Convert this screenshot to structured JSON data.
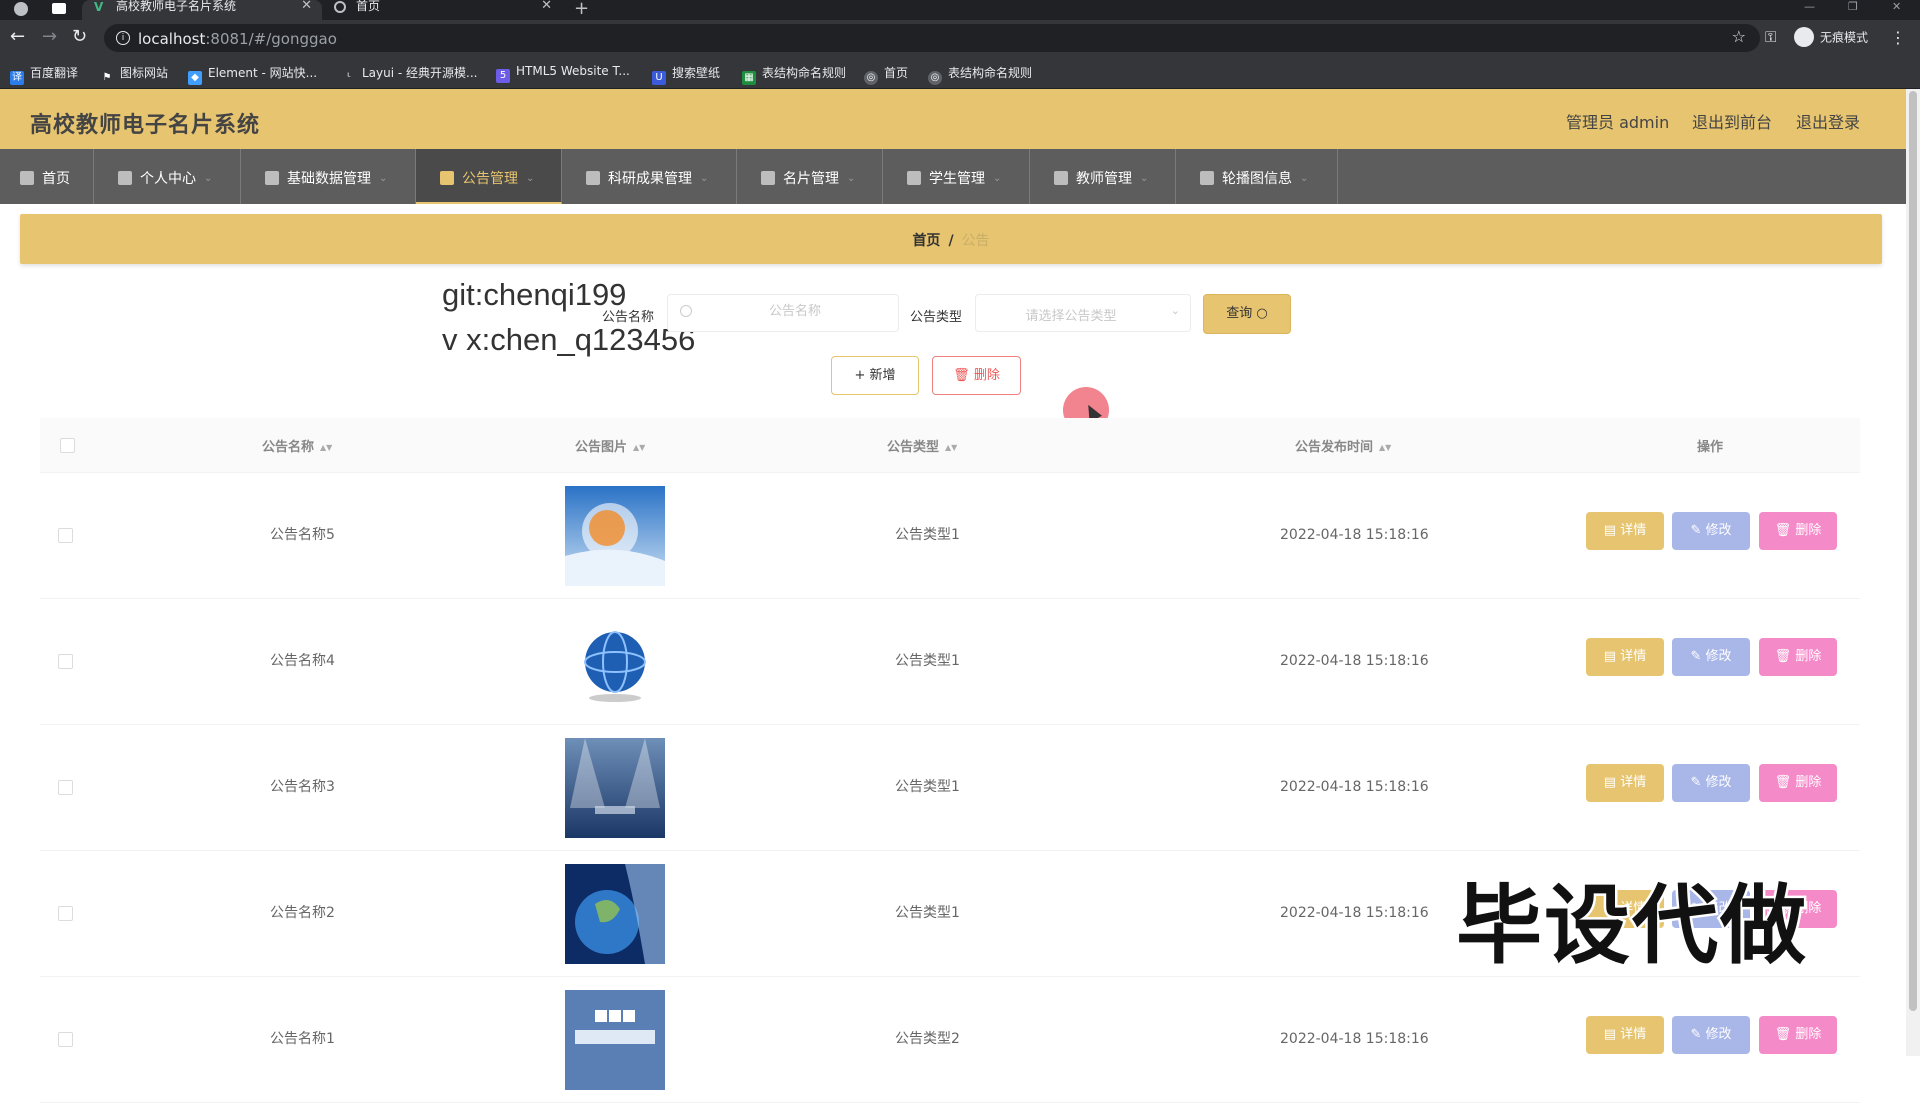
{
  "browser": {
    "tabs": [
      {
        "title": "高校教师电子名片系统",
        "active": true
      },
      {
        "title": "首页",
        "active": false
      }
    ],
    "url_host": "localhost",
    "url_rest": ":8081/#/gonggao",
    "profile_label": "无痕模式",
    "bookmarks": [
      {
        "label": "百度翻译",
        "icon": "baidu-translate-icon"
      },
      {
        "label": "图标网站",
        "icon": "flag-icon"
      },
      {
        "label": "Element - 网站快...",
        "icon": "element-icon"
      },
      {
        "label": "Layui - 经典开源模...",
        "icon": "layui-icon"
      },
      {
        "label": "HTML5 Website T...",
        "icon": "html5-icon"
      },
      {
        "label": "搜索壁纸",
        "icon": "wallpaper-icon"
      },
      {
        "label": "表结构命名规则",
        "icon": "sheet-icon"
      },
      {
        "label": "首页",
        "icon": "globe-icon"
      },
      {
        "label": "表结构命名规则",
        "icon": "globe-icon"
      }
    ]
  },
  "header": {
    "title": "高校教师电子名片系统",
    "admin_label": "管理员 admin",
    "to_front_label": "退出到前台",
    "logout_label": "退出登录"
  },
  "menu": [
    {
      "label": "首页",
      "icon": "home-icon"
    },
    {
      "label": "个人中心",
      "icon": "user-icon"
    },
    {
      "label": "基础数据管理",
      "icon": "user-icon"
    },
    {
      "label": "公告管理",
      "icon": "notice-icon",
      "active": true
    },
    {
      "label": "科研成果管理",
      "icon": "research-icon"
    },
    {
      "label": "名片管理",
      "icon": "card-icon"
    },
    {
      "label": "学生管理",
      "icon": "chart-icon"
    },
    {
      "label": "教师管理",
      "icon": "monitor-icon"
    },
    {
      "label": "轮播图信息",
      "icon": "flag-icon"
    }
  ],
  "breadcrumb": {
    "home": "首页",
    "separator": "/",
    "current": "公告"
  },
  "overlay_text": {
    "git": "git:chenqi199",
    "vx": "v x:chen_q123456",
    "big": "毕设代做"
  },
  "search": {
    "name_label": "公告名称",
    "name_placeholder": "公告名称",
    "type_label": "公告类型",
    "type_placeholder": "请选择公告类型",
    "query_label": "查询"
  },
  "actions": {
    "add_label": "新增",
    "delete_label": "删除"
  },
  "table": {
    "columns": [
      "公告名称",
      "公告图片",
      "公告类型",
      "公告发布时间",
      "操作"
    ],
    "rows": [
      {
        "name": "公告名称5",
        "image": "news-globe-blue",
        "type": "公告类型1",
        "time": "2022-04-18 15:18:16"
      },
      {
        "name": "公告名称4",
        "image": "news-globe-logo",
        "type": "公告类型1",
        "time": "2022-04-18 15:18:16"
      },
      {
        "name": "公告名称3",
        "image": "news-spotlight",
        "type": "公告类型1",
        "time": "2022-04-18 15:18:16"
      },
      {
        "name": "公告名称2",
        "image": "news-earth",
        "type": "公告类型1",
        "time": "2022-04-18 15:18:16"
      },
      {
        "name": "公告名称1",
        "image": "bbc-world",
        "type": "公告类型2",
        "time": "2022-04-18 15:18:16"
      }
    ],
    "detail_label": "详情",
    "edit_label": "修改",
    "delete_label": "删除"
  },
  "colors": {
    "accent": "#e7c46f",
    "menu_bg": "#5d5d5d",
    "edit_btn": "#a9b6e8",
    "delete_btn": "#f58ac8"
  }
}
